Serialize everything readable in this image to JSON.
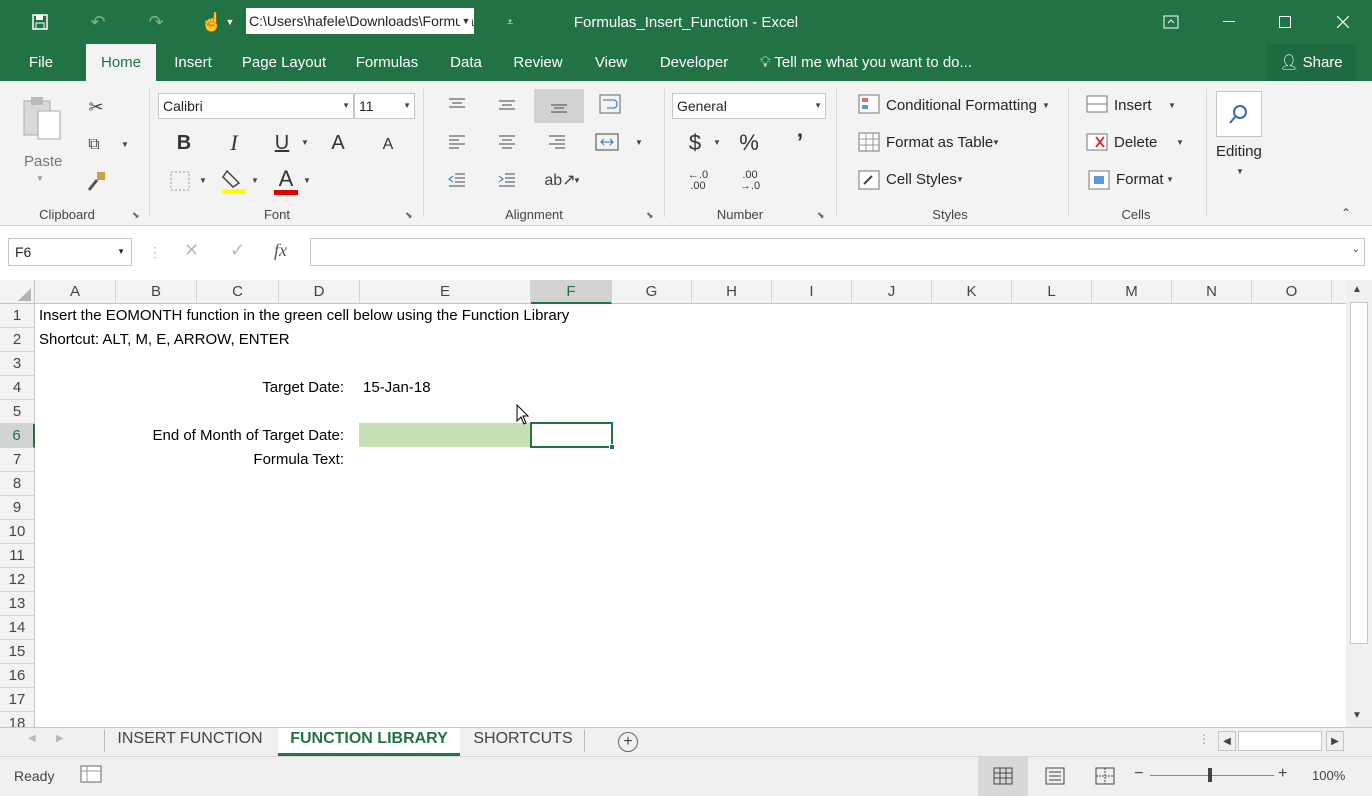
{
  "qat": {
    "path": "C:\\Users\\hafele\\Downloads\\Formulas_Insert_Function.xlsx"
  },
  "window": {
    "title": "Formulas_Insert_Function - Excel"
  },
  "tabs": [
    "File",
    "Home",
    "Insert",
    "Page Layout",
    "Formulas",
    "Data",
    "Review",
    "View",
    "Developer"
  ],
  "tellme": "Tell me what you want to do...",
  "share": "Share",
  "ribbon": {
    "clipboard": {
      "label": "Clipboard",
      "paste": "Paste"
    },
    "font": {
      "label": "Font",
      "name": "Calibri",
      "size": "11",
      "bold": "B",
      "italic": "I",
      "underline": "U",
      "grow": "A",
      "shrink": "A",
      "fontcolor": "A"
    },
    "alignment": {
      "label": "Alignment"
    },
    "number": {
      "label": "Number",
      "format": "General",
      "currency": "$",
      "percent": "%",
      "comma": "’",
      "inc_dec": "←.0\n.00",
      "dec_dec": ".00\n→.0"
    },
    "styles": {
      "label": "Styles",
      "conditional": "Conditional Formatting",
      "table": "Format as Table",
      "cellstyles": "Cell Styles"
    },
    "cells": {
      "label": "Cells",
      "insert": "Insert",
      "delete": "Delete",
      "format": "Format"
    },
    "editing": {
      "label": "Editing"
    },
    "colors": {
      "font_underline": "#e00000",
      "highlight": "#ffff00"
    }
  },
  "formula_bar": {
    "namebox": "F6",
    "fx": "fx",
    "content": ""
  },
  "columns": [
    "A",
    "B",
    "C",
    "D",
    "E",
    "F",
    "G",
    "H",
    "I",
    "J",
    "K",
    "L",
    "M",
    "N",
    "O"
  ],
  "selected_col": "F",
  "rows": [
    "1",
    "2",
    "3",
    "4",
    "5",
    "6",
    "7",
    "8",
    "9",
    "10",
    "11",
    "12",
    "13",
    "14",
    "15",
    "16",
    "17",
    "18"
  ],
  "selected_row": "6",
  "cells": {
    "a1": "Insert the EOMONTH function in the green cell below using the Function Library",
    "a2": "Shortcut: ALT, M, E, ARROW, ENTER",
    "d4": "Target Date:",
    "e4": "15-Jan-18",
    "d6": "End of Month of Target Date:",
    "d7": "Formula Text:",
    "green_fill": "#c6e0b4"
  },
  "sheets": [
    "INSERT FUNCTION",
    "FUNCTION LIBRARY",
    "SHORTCUTS"
  ],
  "active_sheet": "FUNCTION LIBRARY",
  "status": {
    "ready": "Ready",
    "zoom": "100%",
    "zoom_level": 1.0
  }
}
